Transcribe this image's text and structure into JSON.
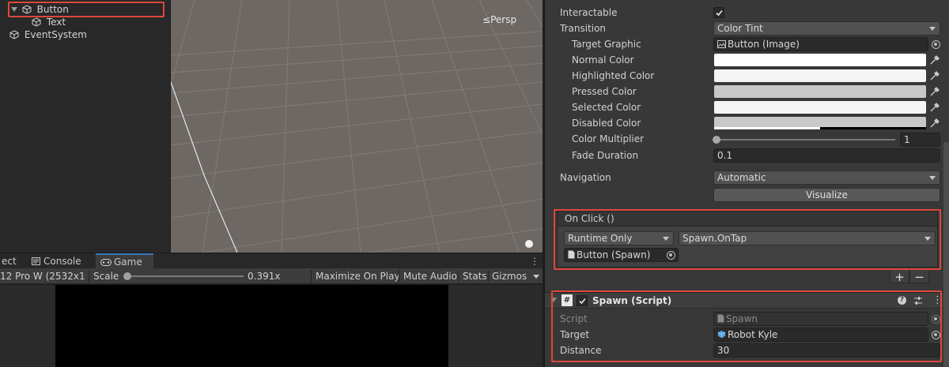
{
  "hierarchy": {
    "items": [
      {
        "label": "Button"
      },
      {
        "label": "Text"
      },
      {
        "label": "EventSystem"
      }
    ]
  },
  "scene": {
    "persp_label": "Persp"
  },
  "game": {
    "tabs": [
      "ect",
      "Console",
      "Game"
    ],
    "resolution": "12 Pro W (2532x1",
    "scale_label": "Scale",
    "scale_value": "0.391x",
    "scale_fraction": 0.0,
    "maximize_label": "Maximize On Play",
    "mute_label": "Mute Audio",
    "stats_label": "Stats",
    "gizmos_label": "Gizmos"
  },
  "inspector": {
    "interactable_label": "Interactable",
    "interactable_checked": true,
    "transition_label": "Transition",
    "transition_value": "Color Tint",
    "target_graphic_label": "Target Graphic",
    "target_graphic_value": "Button (Image)",
    "normal_color_label": "Normal Color",
    "highlighted_color_label": "Highlighted Color",
    "pressed_color_label": "Pressed Color",
    "selected_color_label": "Selected Color",
    "disabled_color_label": "Disabled Color",
    "colors": {
      "normal": "#ffffff",
      "highlighted": "#f5f5f5",
      "pressed": "#c8c8c8",
      "selected": "#f5f5f5",
      "disabled": "#c8c8c8"
    },
    "color_multiplier_label": "Color Multiplier",
    "color_multiplier_value": "1",
    "fade_duration_label": "Fade Duration",
    "fade_duration_value": "0.1",
    "navigation_label": "Navigation",
    "navigation_value": "Automatic",
    "visualize_label": "Visualize",
    "on_click": {
      "header": "On Click ()",
      "runtime_value": "Runtime Only",
      "function_value": "Spawn.OnTap",
      "object_value": "Button (Spawn)",
      "add_label": "+",
      "remove_label": "−"
    },
    "spawn_script": {
      "title": "Spawn (Script)",
      "script_label": "Script",
      "script_value": "Spawn",
      "target_label": "Target",
      "target_value": "Robot Kyle",
      "distance_label": "Distance",
      "distance_value": "30"
    }
  },
  "theme": {
    "accent": "#3a79bb",
    "highlight_box": "#e0473a"
  }
}
